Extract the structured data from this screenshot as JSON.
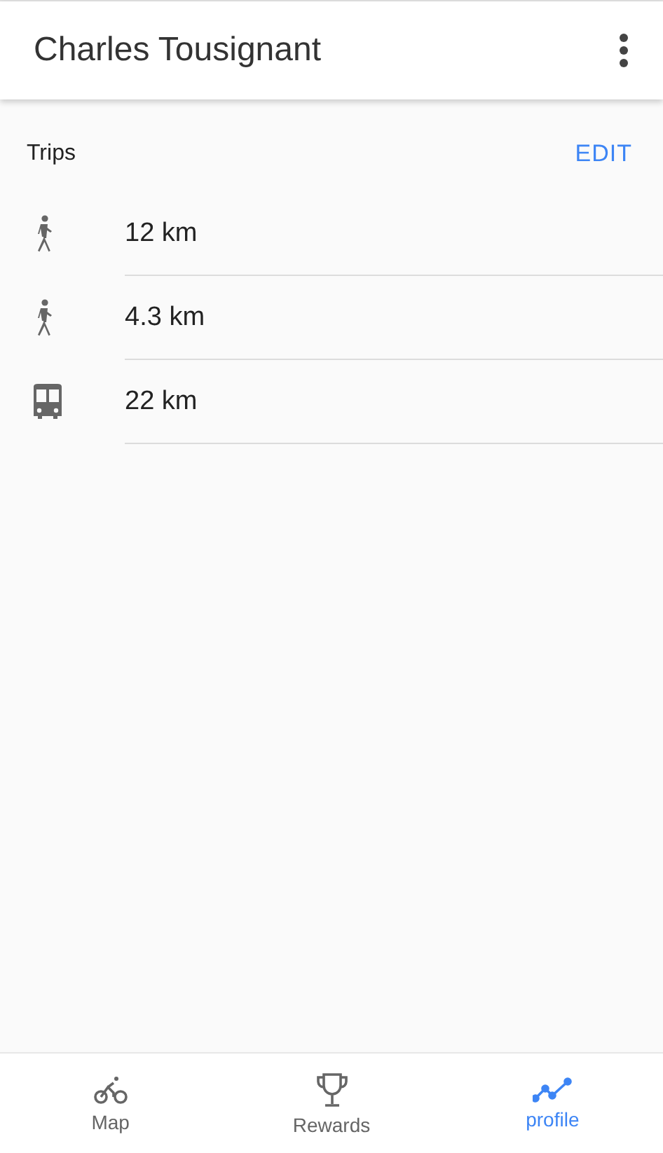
{
  "header": {
    "title": "Charles Tousignant"
  },
  "trips": {
    "title": "Trips",
    "action": "EDIT",
    "items": [
      {
        "kind": "walk",
        "distance": "12 km"
      },
      {
        "kind": "walk",
        "distance": "4.3 km"
      },
      {
        "kind": "bus",
        "distance": "22 km"
      }
    ]
  },
  "nav": [
    {
      "kind": "bike",
      "label": "Map",
      "selected": false
    },
    {
      "kind": "trophy",
      "label": "Rewards",
      "selected": false
    },
    {
      "kind": "trend",
      "label": "profile",
      "selected": true
    }
  ]
}
